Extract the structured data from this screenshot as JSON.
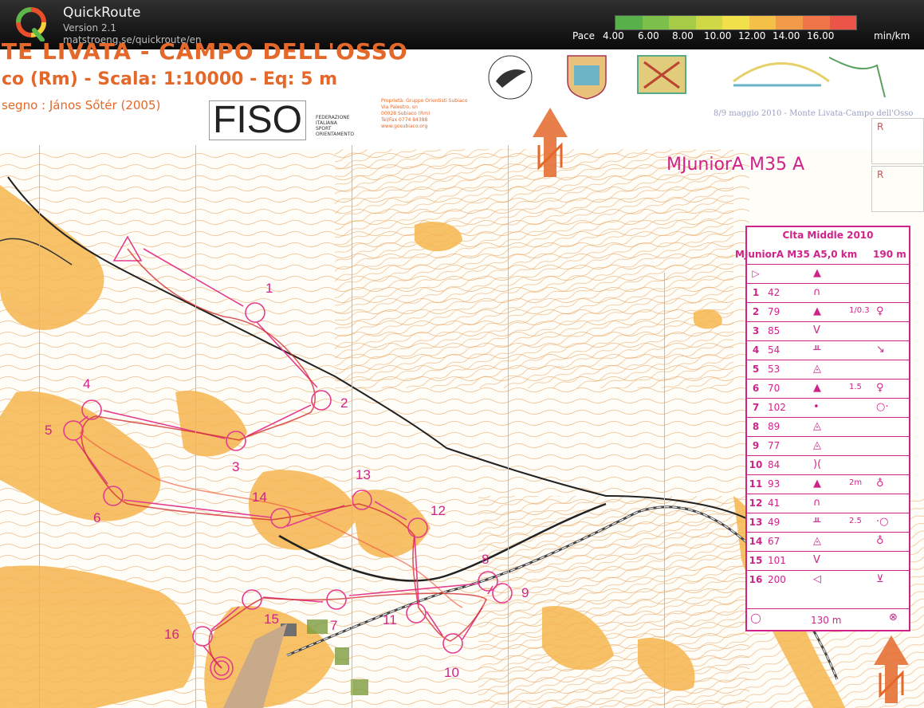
{
  "app": {
    "name": "QuickRoute",
    "version": "Version 2.1",
    "url": "matstroeng.se/quickroute/en"
  },
  "pace_legend": {
    "label": "Pace",
    "ticks": [
      "4.00",
      "6.00",
      "8.00",
      "10.00",
      "12.00",
      "14.00",
      "16.00"
    ],
    "unit": "min/km",
    "colors": [
      "#58b04b",
      "#7cbf4a",
      "#a6cc47",
      "#d0d845",
      "#f2e04a",
      "#f4c048",
      "#f29a48",
      "#ef7548",
      "#ec5447"
    ]
  },
  "map": {
    "title_strip": "TE LIVATA - CAMPO DELL'OSSO",
    "scale_line": "co (Rm) - Scala: 1:10000 - Eq: 5 m",
    "drawer": "segno :  János Sőtér (2005)",
    "fiso": "FISO",
    "fiso_sub": [
      "FEDERAZIONE",
      "ITALIANA",
      "SPORT",
      "ORIENTAMENTO"
    ],
    "owner": [
      "Proprietà: Gruppo Orientisti Subiaco",
      "Via Palestro, sn",
      "00028 Subiaco (Rm)",
      "Tel/Fax 0774 84388",
      "www.gosubiaco.org"
    ],
    "event_date": "8/9 maggio 2010 - Monte Livata-Campo dell'Osso",
    "course_name": "MJuniorA  M35 A",
    "r_label": "R",
    "controls": [
      {
        "num": "1"
      },
      {
        "num": "2"
      },
      {
        "num": "3"
      },
      {
        "num": "4"
      },
      {
        "num": "5"
      },
      {
        "num": "6"
      },
      {
        "num": "7"
      },
      {
        "num": "8"
      },
      {
        "num": "9"
      },
      {
        "num": "10"
      },
      {
        "num": "11"
      },
      {
        "num": "12"
      },
      {
        "num": "13"
      },
      {
        "num": "14"
      },
      {
        "num": "15"
      },
      {
        "num": "16"
      }
    ]
  },
  "descriptions": {
    "event": "Clta Middle 2010",
    "course": "MJuniorA   M35 A5,0 km",
    "climb": "190 m",
    "rows": [
      {
        "n": "1",
        "code": "42",
        "sym": "∩",
        "extra": "",
        "v": ""
      },
      {
        "n": "2",
        "code": "79",
        "sym": "▲",
        "extra": "1/0.3",
        "v": "♀"
      },
      {
        "n": "3",
        "code": "85",
        "sym": "V",
        "extra": "",
        "v": ""
      },
      {
        "n": "4",
        "code": "54",
        "sym": "ᚇ",
        "extra": "",
        "v": "↘"
      },
      {
        "n": "5",
        "code": "53",
        "sym": "◬",
        "extra": "",
        "v": ""
      },
      {
        "n": "6",
        "code": "70",
        "sym": "▲",
        "extra": "1.5",
        "v": "♀"
      },
      {
        "n": "7",
        "code": "102",
        "sym": "•",
        "extra": "",
        "v": "○·"
      },
      {
        "n": "8",
        "code": "89",
        "sym": "◬",
        "extra": "",
        "v": ""
      },
      {
        "n": "9",
        "code": "77",
        "sym": "◬",
        "extra": "",
        "v": ""
      },
      {
        "n": "10",
        "code": "84",
        "sym": ")(",
        "extra": "",
        "v": ""
      },
      {
        "n": "11",
        "code": "93",
        "sym": "▲",
        "extra": "2m",
        "v": "♁"
      },
      {
        "n": "12",
        "code": "41",
        "sym": "∩",
        "extra": "",
        "v": ""
      },
      {
        "n": "13",
        "code": "49",
        "sym": "ᚇ",
        "extra": "2.5",
        "v": "·○"
      },
      {
        "n": "14",
        "code": "67",
        "sym": "◬",
        "extra": "",
        "v": "♁"
      },
      {
        "n": "15",
        "code": "101",
        "sym": "V",
        "extra": "",
        "v": ""
      },
      {
        "n": "16",
        "code": "200",
        "sym": "◁",
        "extra": "",
        "v": "⊻"
      }
    ],
    "finish_dist": "130 m"
  }
}
